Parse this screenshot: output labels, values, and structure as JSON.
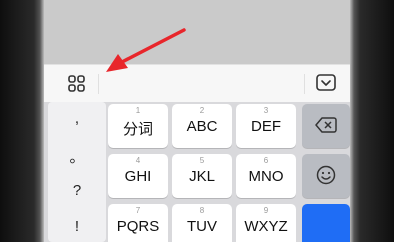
{
  "toolbar": {
    "grid_icon": "grid-menu-icon",
    "collapse_icon": "keyboard-collapse-icon"
  },
  "punctuation": [
    ",",
    "。",
    "?",
    "!"
  ],
  "keys": {
    "row1": [
      {
        "num": "1",
        "label": "分词"
      },
      {
        "num": "2",
        "label": "ABC"
      },
      {
        "num": "3",
        "label": "DEF"
      }
    ],
    "row2": [
      {
        "num": "4",
        "label": "GHI"
      },
      {
        "num": "5",
        "label": "JKL"
      },
      {
        "num": "6",
        "label": "MNO"
      }
    ],
    "row3": [
      {
        "num": "7",
        "label": "PQRS"
      },
      {
        "num": "8",
        "label": "TUV"
      },
      {
        "num": "9",
        "label": "WXYZ"
      }
    ]
  },
  "func_keys": {
    "backspace_icon": "backspace-icon",
    "emoji_icon": "emoji-icon"
  },
  "colors": {
    "annotation_arrow": "#e8262b",
    "enter_key": "#1f6df5"
  }
}
